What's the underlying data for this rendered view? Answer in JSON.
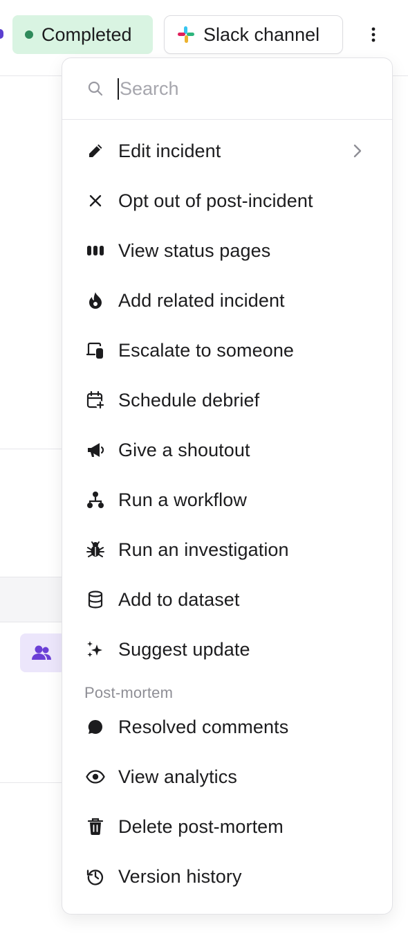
{
  "header": {
    "status_label": "Completed",
    "status_color": "#2f8a5b",
    "slack_label": "Slack channel",
    "more_icon": "kebab-icon"
  },
  "menu": {
    "search": {
      "placeholder": "Search",
      "value": ""
    },
    "items": [
      {
        "label": "Edit incident",
        "icon": "pencil-icon",
        "has_submenu": true
      },
      {
        "label": "Opt out of post-incident",
        "icon": "close-icon"
      },
      {
        "label": "View status pages",
        "icon": "status-bars-icon"
      },
      {
        "label": "Add related incident",
        "icon": "flame-icon"
      },
      {
        "label": "Escalate to someone",
        "icon": "escalate-icon"
      },
      {
        "label": "Schedule debrief",
        "icon": "calendar-plus-icon"
      },
      {
        "label": "Give a shoutout",
        "icon": "megaphone-icon"
      },
      {
        "label": "Run a workflow",
        "icon": "workflow-icon"
      },
      {
        "label": "Run an investigation",
        "icon": "bug-icon"
      },
      {
        "label": "Add to dataset",
        "icon": "database-icon"
      },
      {
        "label": "Suggest update",
        "icon": "sparkles-icon"
      }
    ],
    "section_title": "Post-mortem",
    "section_items": [
      {
        "label": "Resolved comments",
        "icon": "comment-icon"
      },
      {
        "label": "View analytics",
        "icon": "eye-icon"
      },
      {
        "label": "Delete post-mortem",
        "icon": "trash-icon"
      },
      {
        "label": "Version history",
        "icon": "history-icon"
      }
    ]
  }
}
